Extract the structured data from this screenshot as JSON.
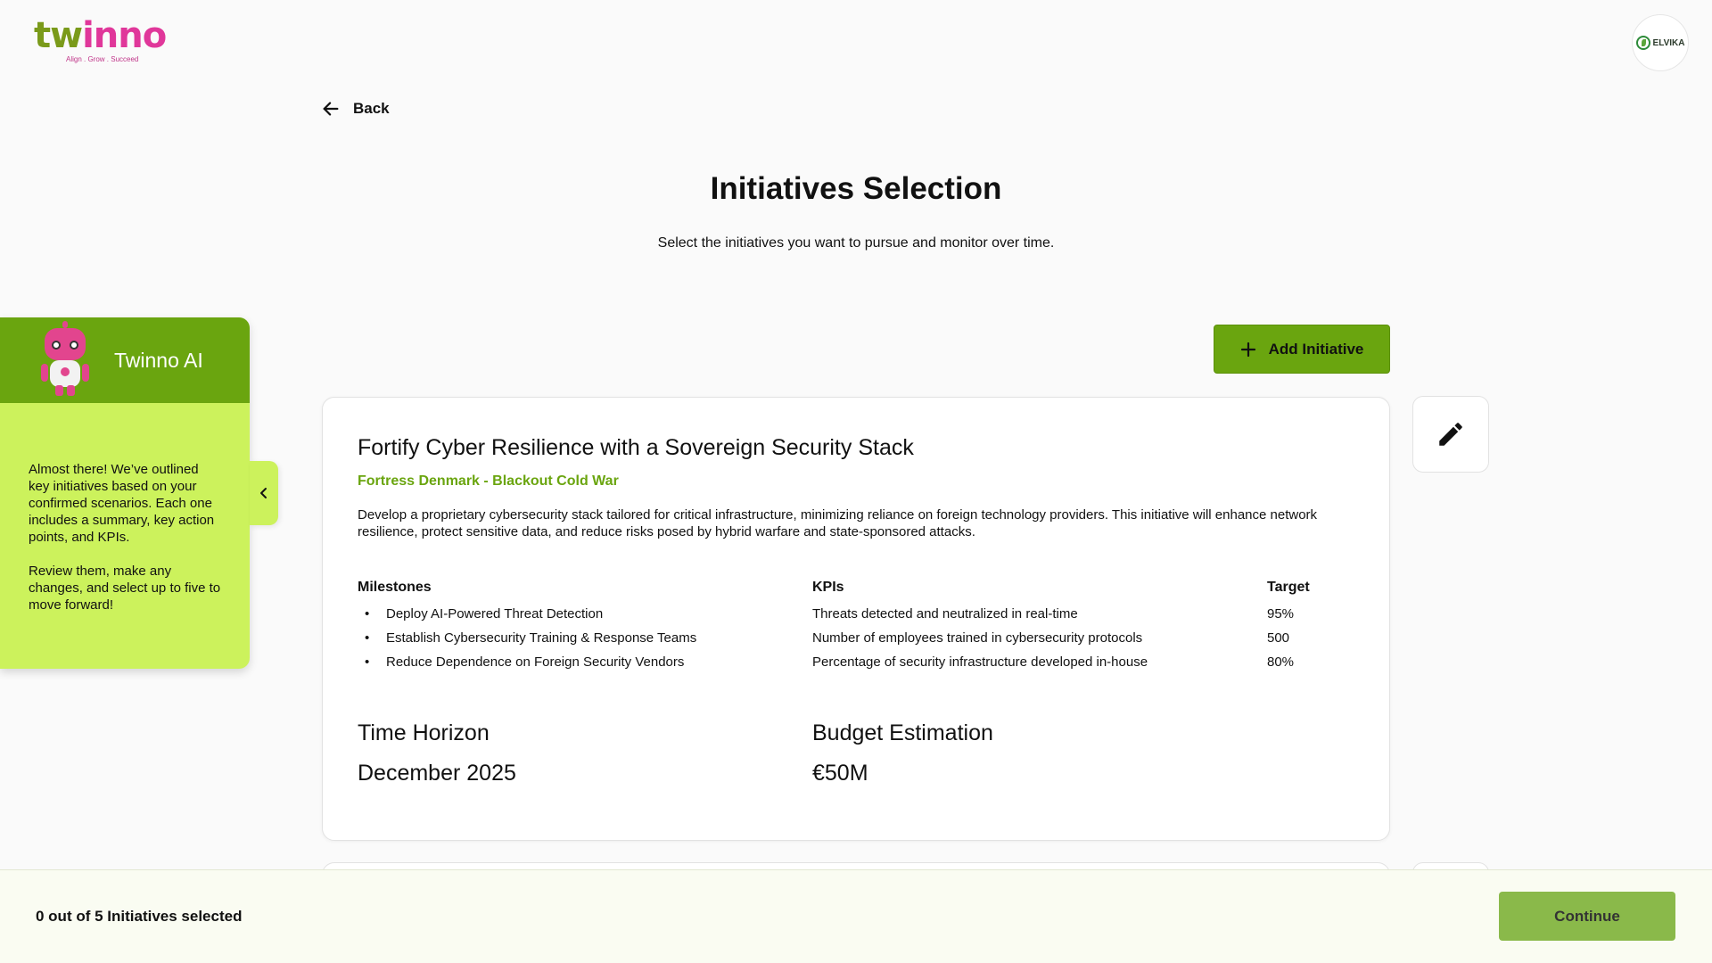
{
  "header": {
    "logo_part1": "tw",
    "logo_part2": "inn",
    "logo_part3": "o",
    "logo_tagline": "Align . Grow . Succeed",
    "org_name": "ELVIKA"
  },
  "nav": {
    "back_label": "Back"
  },
  "page": {
    "title": "Initiatives Selection",
    "subtitle": "Select the initiatives you want to pursue and monitor over time."
  },
  "assistant": {
    "name": "Twinno AI",
    "message_1": "Almost there! We’ve outlined key initiatives based on your confirmed scenarios. Each one includes a summary, key action points, and KPIs.",
    "message_2": "Review them, make any changes, and select up to five to move forward!"
  },
  "actions": {
    "add_initiative_label": "Add Initiative"
  },
  "initiative": {
    "title": "Fortify Cyber Resilience with a Sovereign Security Stack",
    "scenario": "Fortress Denmark - Blackout Cold War",
    "description": "Develop a proprietary cybersecurity stack tailored for critical infrastructure, minimizing reliance on foreign technology providers. This initiative will enhance network resilience, protect sensitive data, and reduce risks posed by hybrid warfare and state-sponsored attacks.",
    "milestones_header": "Milestones",
    "kpis_header": "KPIs",
    "target_header": "Target",
    "milestones": [
      "Deploy AI-Powered Threat Detection",
      "Establish Cybersecurity Training & Response Teams",
      "Reduce Dependence on Foreign Security Vendors"
    ],
    "kpis": [
      "Threats detected and neutralized in real-time",
      "Number of employees trained in cybersecurity protocols",
      "Percentage of security infrastructure developed in-house"
    ],
    "targets": [
      "95%",
      "500",
      "80%"
    ],
    "time_horizon_label": "Time Horizon",
    "time_horizon_value": "December 2025",
    "budget_label": "Budget Estimation",
    "budget_value": "€50M"
  },
  "footer": {
    "selected_count_text": "0 out of 5 Initiatives selected",
    "continue_label": "Continue"
  },
  "colors": {
    "brand_green": "#6aa50f",
    "assistant_bg": "#ccf25c",
    "brand_pink": "#e0379a",
    "continue_bg": "#8ab94a"
  }
}
